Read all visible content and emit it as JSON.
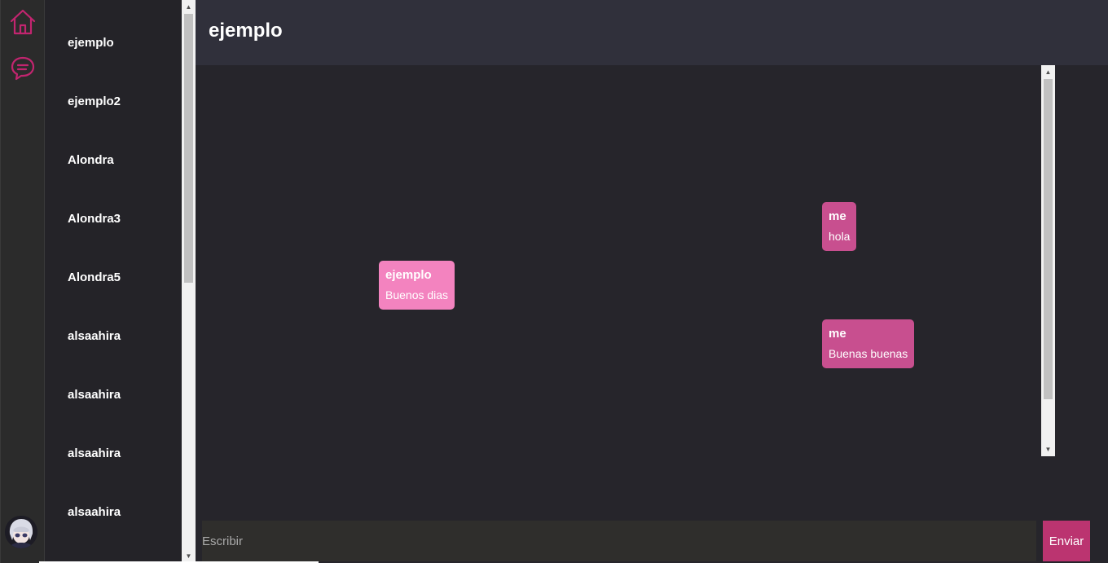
{
  "nav": {
    "home_icon": "home-icon",
    "chat_icon": "chat-bubble-icon",
    "accent_color": "#c2256f"
  },
  "contacts": [
    {
      "name": "ejemplo"
    },
    {
      "name": "ejemplo2"
    },
    {
      "name": "Alondra"
    },
    {
      "name": "Alondra3"
    },
    {
      "name": "Alondra5"
    },
    {
      "name": "alsaahira"
    },
    {
      "name": "alsaahira"
    },
    {
      "name": "alsaahira"
    },
    {
      "name": "alsaahira"
    }
  ],
  "chat": {
    "title": "ejemplo",
    "messages": [
      {
        "author": "me",
        "text": "hola",
        "mine": true
      },
      {
        "author": "ejemplo",
        "text": "Buenos dias",
        "mine": false
      },
      {
        "author": "me",
        "text": "Buenas buenas",
        "mine": true
      }
    ]
  },
  "composer": {
    "placeholder": "Escribir",
    "send_label": "Enviar"
  },
  "colors": {
    "mine_bubble": "#c84f8f",
    "their_bubble": "#f383bf",
    "send_button": "#bb3470"
  }
}
